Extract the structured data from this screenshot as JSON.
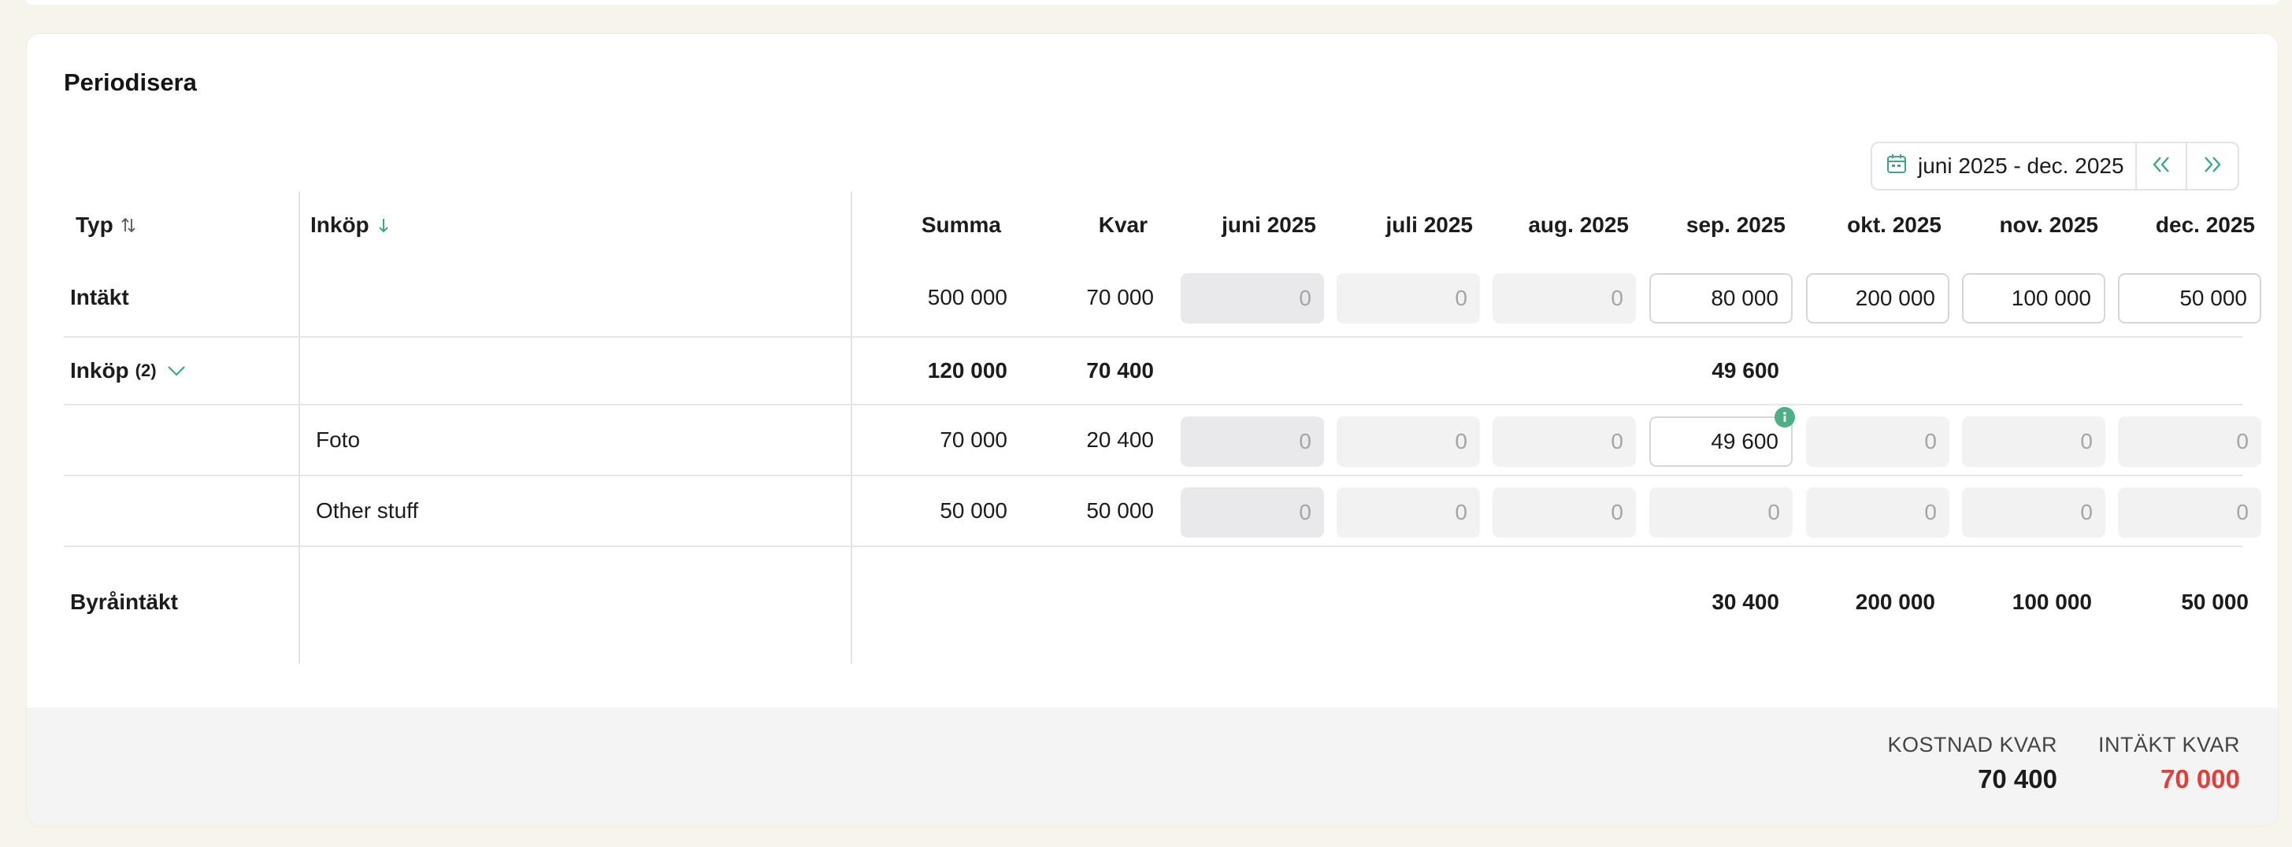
{
  "section_title": "Periodisera",
  "date_range": {
    "label": "juni 2025 - dec. 2025"
  },
  "headers": {
    "typ": "Typ",
    "inkop": "Inköp",
    "summa": "Summa",
    "kvar": "Kvar",
    "months": [
      "juni 2025",
      "juli 2025",
      "aug. 2025",
      "sep. 2025",
      "okt. 2025",
      "nov. 2025",
      "dec. 2025"
    ]
  },
  "rows": {
    "intakt": {
      "label": "Intäkt",
      "summa": "500 000",
      "kvar": "70 000",
      "months": [
        "0",
        "0",
        "0",
        "80 000",
        "200 000",
        "100 000",
        "50 000"
      ]
    },
    "inkop_group": {
      "label": "Inköp",
      "count": "(2)",
      "summa": "120 000",
      "kvar": "70 400",
      "sep": "49 600"
    },
    "foto": {
      "label": "Foto",
      "summa": "70 000",
      "kvar": "20 400",
      "months": [
        "0",
        "0",
        "0",
        "49 600",
        "0",
        "0",
        "0"
      ]
    },
    "other": {
      "label": "Other stuff",
      "summa": "50 000",
      "kvar": "50 000",
      "months": [
        "0",
        "0",
        "0",
        "0",
        "0",
        "0",
        "0"
      ]
    },
    "byra": {
      "label": "Byråintäkt",
      "sep": "30 400",
      "okt": "200 000",
      "nov": "100 000",
      "dec": "50 000"
    }
  },
  "footer": {
    "kostnad_label": "KOSTNAD KVAR",
    "kostnad_value": "70 400",
    "intakt_label": "INTÄKT KVAR",
    "intakt_value": "70 000"
  },
  "colors": {
    "accent": "#3aa982",
    "negative": "#e0403a",
    "badge": "#4caf85"
  },
  "icons": {
    "calendar": "calendar-icon",
    "prev": "double-chevron-left-icon",
    "next": "double-chevron-right-icon",
    "sort_typ": "sort-updown-icon",
    "sort_inkop": "arrow-down-icon",
    "expand": "chevron-down-icon",
    "info_badge": "info-icon"
  }
}
